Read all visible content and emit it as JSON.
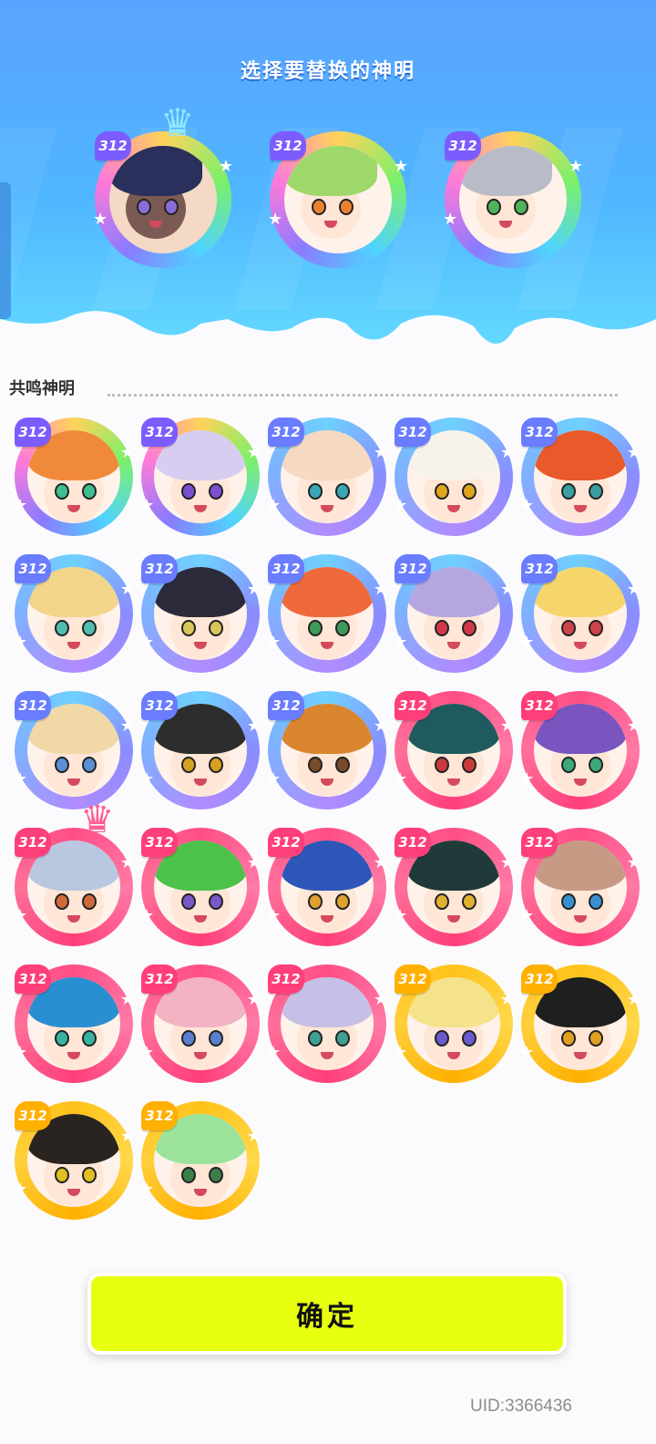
{
  "header": {
    "title": "选择要替换的神明"
  },
  "section": {
    "label": "共鸣神明"
  },
  "selected": [
    {
      "level": "312",
      "tier": "rainbow",
      "hair": "#2b2f5c",
      "skin": "#7a5a52",
      "eye": "#8a6cd6",
      "crown": "diamond"
    },
    {
      "level": "312",
      "tier": "rainbow",
      "hair": "#9fd86a",
      "skin": "#ffe6d6",
      "eye": "#e98230",
      "crown": ""
    },
    {
      "level": "312",
      "tier": "rainbow",
      "hair": "#b9bcc6",
      "skin": "#ffe6d6",
      "eye": "#4fb35a",
      "crown": ""
    }
  ],
  "characters": [
    {
      "level": "312",
      "tier": "rainbow",
      "hair": "#f08a3a",
      "eye": "#3fbf8f",
      "crown": ""
    },
    {
      "level": "312",
      "tier": "rainbow",
      "hair": "#d6cdf0",
      "eye": "#7a4fd0",
      "crown": ""
    },
    {
      "level": "312",
      "tier": "purple",
      "hair": "#f5d9c0",
      "eye": "#3aa7b8",
      "crown": ""
    },
    {
      "level": "312",
      "tier": "purple",
      "hair": "#f7f2ea",
      "eye": "#e0a51e",
      "crown": ""
    },
    {
      "level": "312",
      "tier": "purple",
      "hair": "#e85a2a",
      "eye": "#3a9fa0",
      "crown": ""
    },
    {
      "level": "312",
      "tier": "purple",
      "hair": "#f2d58a",
      "eye": "#4fbdb0",
      "crown": ""
    },
    {
      "level": "312",
      "tier": "purple",
      "hair": "#2a2a3a",
      "eye": "#d9c65a",
      "crown": ""
    },
    {
      "level": "312",
      "tier": "purple",
      "hair": "#ef6a3a",
      "eye": "#3e9a5a",
      "crown": ""
    },
    {
      "level": "312",
      "tier": "purple",
      "hair": "#b5a6e0",
      "eye": "#cf3a4a",
      "crown": ""
    },
    {
      "level": "312",
      "tier": "purple",
      "hair": "#f6d66a",
      "eye": "#d0424c",
      "crown": ""
    },
    {
      "level": "312",
      "tier": "purple",
      "hair": "#f0d9a6",
      "eye": "#5b8fd6",
      "crown": ""
    },
    {
      "level": "312",
      "tier": "purple",
      "hair": "#2d2d2d",
      "eye": "#d6a020",
      "crown": ""
    },
    {
      "level": "312",
      "tier": "purple",
      "hair": "#d9862f",
      "eye": "#7a4b2a",
      "crown": ""
    },
    {
      "level": "312",
      "tier": "pink",
      "hair": "#1f5b5e",
      "eye": "#c83a3a",
      "crown": ""
    },
    {
      "level": "312",
      "tier": "pink",
      "hair": "#7a55c0",
      "eye": "#3ca97a",
      "crown": ""
    },
    {
      "level": "312",
      "tier": "pink",
      "hair": "#b9c7e0",
      "eye": "#d06a3a",
      "crown": "pink"
    },
    {
      "level": "312",
      "tier": "pink",
      "hair": "#4cc24a",
      "eye": "#7a58c8",
      "crown": ""
    },
    {
      "level": "312",
      "tier": "pink",
      "hair": "#2e56b8",
      "eye": "#e0a030",
      "crown": ""
    },
    {
      "level": "312",
      "tier": "pink",
      "hair": "#203a3a",
      "eye": "#e0b030",
      "crown": ""
    },
    {
      "level": "312",
      "tier": "pink",
      "hair": "#c79a86",
      "eye": "#3a8fd0",
      "crown": ""
    },
    {
      "level": "312",
      "tier": "pink",
      "hair": "#2a8fd0",
      "eye": "#38b3a0",
      "crown": ""
    },
    {
      "level": "312",
      "tier": "pink",
      "hair": "#f3b3c3",
      "eye": "#5a7fd0",
      "crown": ""
    },
    {
      "level": "312",
      "tier": "pink",
      "hair": "#c7c0e6",
      "eye": "#3f9f90",
      "crown": ""
    },
    {
      "level": "312",
      "tier": "gold",
      "hair": "#f4e38a",
      "eye": "#6a5ad0",
      "crown": ""
    },
    {
      "level": "312",
      "tier": "gold",
      "hair": "#1f1f1f",
      "eye": "#e0a020",
      "crown": ""
    },
    {
      "level": "312",
      "tier": "gold",
      "hair": "#2a2420",
      "eye": "#e0c020",
      "crown": ""
    },
    {
      "level": "312",
      "tier": "gold",
      "hair": "#9be39a",
      "eye": "#3a7f4a",
      "crown": ""
    }
  ],
  "tier_colors": {
    "rainbow": {
      "ring": "conic-gradient(#ffd35a,#7cf06a,#4fd3ff,#8a7bff,#ff7ad9,#ffd35a)",
      "level": "#7c5cff"
    },
    "purple": {
      "ring": "conic-gradient(#6fd0ff,#8a8cff,#b08cff,#7fb0ff,#6fd0ff)",
      "level": "#6a7cff"
    },
    "pink": {
      "ring": "conic-gradient(#ff4f86,#ff7aa6,#ff3f7a,#ff6f9a,#ff4f86)",
      "level": "#ff3f7a"
    },
    "gold": {
      "ring": "conic-gradient(#ffc21a,#ffd84a,#ffb000,#ffcf3a,#ffc21a)",
      "level": "#ffb000"
    }
  },
  "confirm": {
    "label": "确定"
  },
  "footer": {
    "uid": "UID:3366436"
  }
}
